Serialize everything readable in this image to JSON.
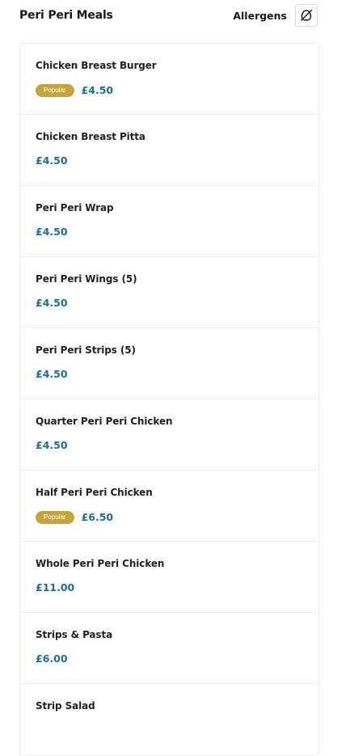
{
  "header": {
    "title": "Peri Peri Meals",
    "allergens_label": "Allergens",
    "allergens_icon": "no-allergen-icon"
  },
  "colors": {
    "price": "#1f6e8c",
    "badge": "#c6a43b"
  },
  "items": [
    {
      "name": "Chicken Breast Burger",
      "badge": "Popular",
      "price": "£4.50"
    },
    {
      "name": "Chicken Breast Pitta",
      "badge": null,
      "price": "£4.50"
    },
    {
      "name": "Peri Peri Wrap",
      "badge": null,
      "price": "£4.50"
    },
    {
      "name": "Peri Peri Wings (5)",
      "badge": null,
      "price": "£4.50"
    },
    {
      "name": "Peri Peri Strips (5)",
      "badge": null,
      "price": "£4.50"
    },
    {
      "name": "Quarter Peri Peri Chicken",
      "badge": null,
      "price": "£4.50"
    },
    {
      "name": "Half Peri Peri Chicken",
      "badge": "Popular",
      "price": "£6.50"
    },
    {
      "name": "Whole Peri Peri Chicken",
      "badge": null,
      "price": "£11.00"
    },
    {
      "name": "Strips & Pasta",
      "badge": null,
      "price": "£6.00"
    },
    {
      "name": "Strip Salad",
      "badge": null,
      "price": null
    }
  ]
}
